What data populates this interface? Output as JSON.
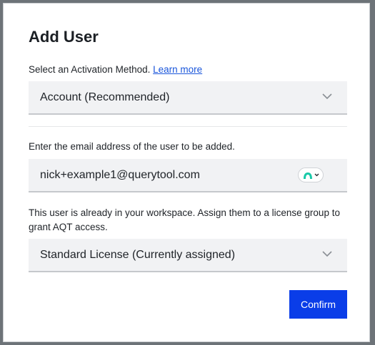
{
  "dialog": {
    "title": "Add User"
  },
  "activation": {
    "label": "Select an Activation Method.",
    "learn_more": "Learn more",
    "selected": "Account (Recommended)"
  },
  "email": {
    "label": "Enter the email address of the user to be added.",
    "value": "nick+example1@querytool.com",
    "extension_icon": "password-manager-icon"
  },
  "license": {
    "notice": "This user is already in your workspace. Assign them to a license group to grant AQT access.",
    "selected": "Standard License (Currently assigned)"
  },
  "actions": {
    "confirm_label": "Confirm"
  },
  "colors": {
    "backdrop": "#6d7378",
    "accent": "#0a3de8",
    "link": "#1a56db",
    "field_bg": "#f1f2f4",
    "extension_green": "#19c9a8"
  }
}
